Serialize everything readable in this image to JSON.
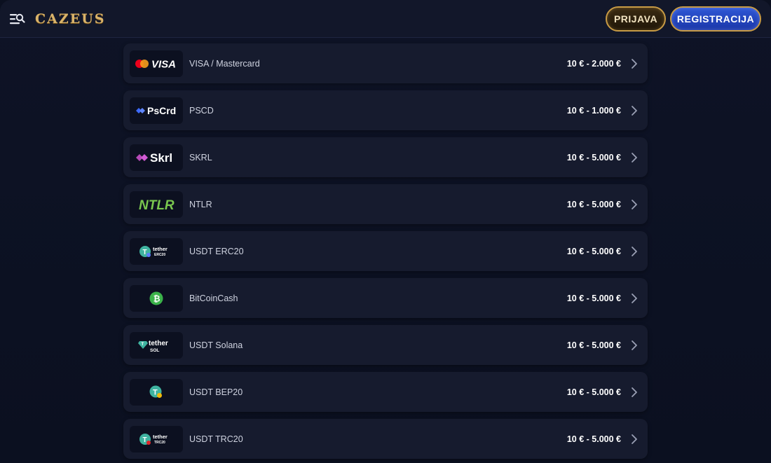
{
  "header": {
    "logo_text": "CAZEUS",
    "login_label": "PRIJAVA",
    "register_label": "REGISTRACIJA"
  },
  "payment_methods": [
    {
      "name": "VISA / Mastercard",
      "limits": "10 € - 2.000 €",
      "icon": "visa-mastercard-logo",
      "logo_text": "VISA"
    },
    {
      "name": "PSCD",
      "limits": "10 € - 1.000 €",
      "icon": "pscrd-logo",
      "logo_text": "PsCrd"
    },
    {
      "name": "SKRL",
      "limits": "10 € - 5.000 €",
      "icon": "skrl-logo",
      "logo_text": "Skrl"
    },
    {
      "name": "NTLR",
      "limits": "10 € - 5.000 €",
      "icon": "ntlr-logo",
      "logo_text": "NTLR"
    },
    {
      "name": "USDT ERC20",
      "limits": "10 € - 5.000 €",
      "icon": "tether-erc20-logo",
      "logo_text": "tether",
      "logo_sub": "ERC20"
    },
    {
      "name": "BitCoinCash",
      "limits": "10 € - 5.000 €",
      "icon": "bitcoincash-logo"
    },
    {
      "name": "USDT Solana",
      "limits": "10 € - 5.000 €",
      "icon": "tether-sol-logo",
      "logo_text": "tether",
      "logo_sub": "SOL"
    },
    {
      "name": "USDT BEP20",
      "limits": "10 € - 5.000 €",
      "icon": "tether-bep20-logo"
    },
    {
      "name": "USDT TRC20",
      "limits": "10 € - 5.000 €",
      "icon": "tether-trc20-logo",
      "logo_text": "tether",
      "logo_sub": "TRC20"
    }
  ],
  "colors": {
    "background": "#0b1020",
    "row_background": "#161b2e",
    "accent_gold": "#c89b45",
    "register_blue": "#2f57d6"
  }
}
